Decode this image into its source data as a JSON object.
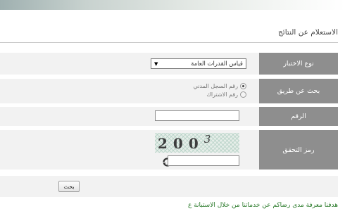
{
  "section_title": "الاستعلام عن النتائج",
  "form": {
    "test_type": {
      "label": "نوع الاختبار",
      "selected": "قياس القدرات العامة"
    },
    "search_by": {
      "label": "بحث عن طريق",
      "options": [
        {
          "text": "رقم السجل المدني",
          "checked": true
        },
        {
          "text": "رقم الاشتراك",
          "checked": false
        }
      ]
    },
    "number": {
      "label": "الرقم",
      "value": ""
    },
    "verification": {
      "label": "رمز التحقق",
      "captcha_text": "2003",
      "value": ""
    },
    "search_button": "بحث"
  },
  "footer_text": "هدفنا معرفة مدى رضاكم عن خدماتنا من خلال الاستبانة ع",
  "colors": {
    "label_bg": "#8e8e8e",
    "row_bg": "#f2f2f2",
    "footer_text": "#2a7a2a"
  },
  "icons": [
    "refresh-icon",
    "dropdown-arrow-icon"
  ]
}
